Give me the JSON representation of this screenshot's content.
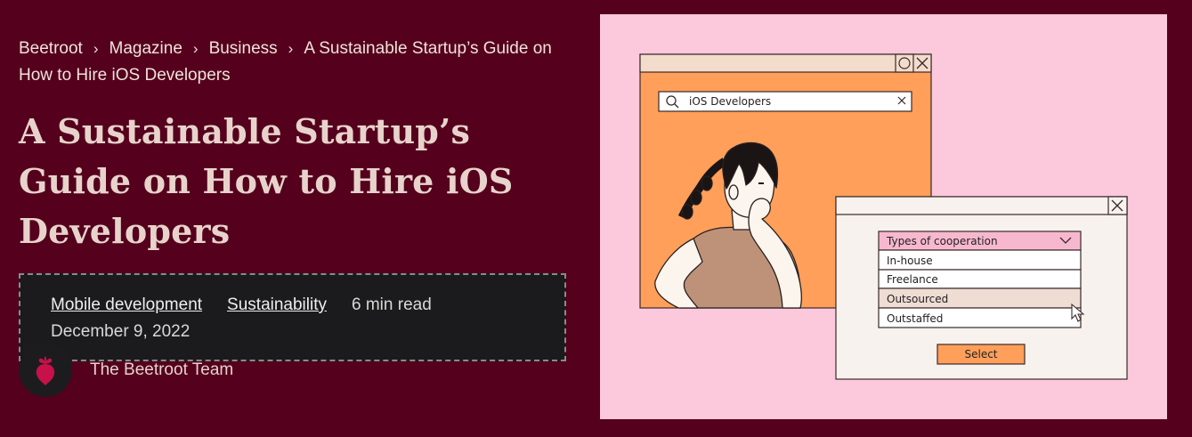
{
  "breadcrumb": {
    "items": [
      "Beetroot",
      "Magazine",
      "Business"
    ],
    "current": "A Sustainable Startup’s Guide on How to Hire iOS Developers"
  },
  "article": {
    "title": "A Sustainable Startup’s Guide on How to Hire iOS Developers",
    "tags": [
      "Mobile development",
      "Sustainability"
    ],
    "read_time": "6 min read",
    "date": "December 9, 2022"
  },
  "author": {
    "name": "The Beetroot Team"
  },
  "illustration": {
    "search_text": "iOS Developers",
    "dropdown_label": "Types of cooperation",
    "options": [
      "In-house",
      "Freelance",
      "Outsourced",
      "Outstaffed"
    ],
    "button_label": "Select"
  },
  "colors": {
    "background": "#55001d",
    "meta_box": "#1b1b1d",
    "art_background": "#fbc8dc",
    "window_orange": "#ff9f5a",
    "accent_pink": "#f7b8cf"
  }
}
